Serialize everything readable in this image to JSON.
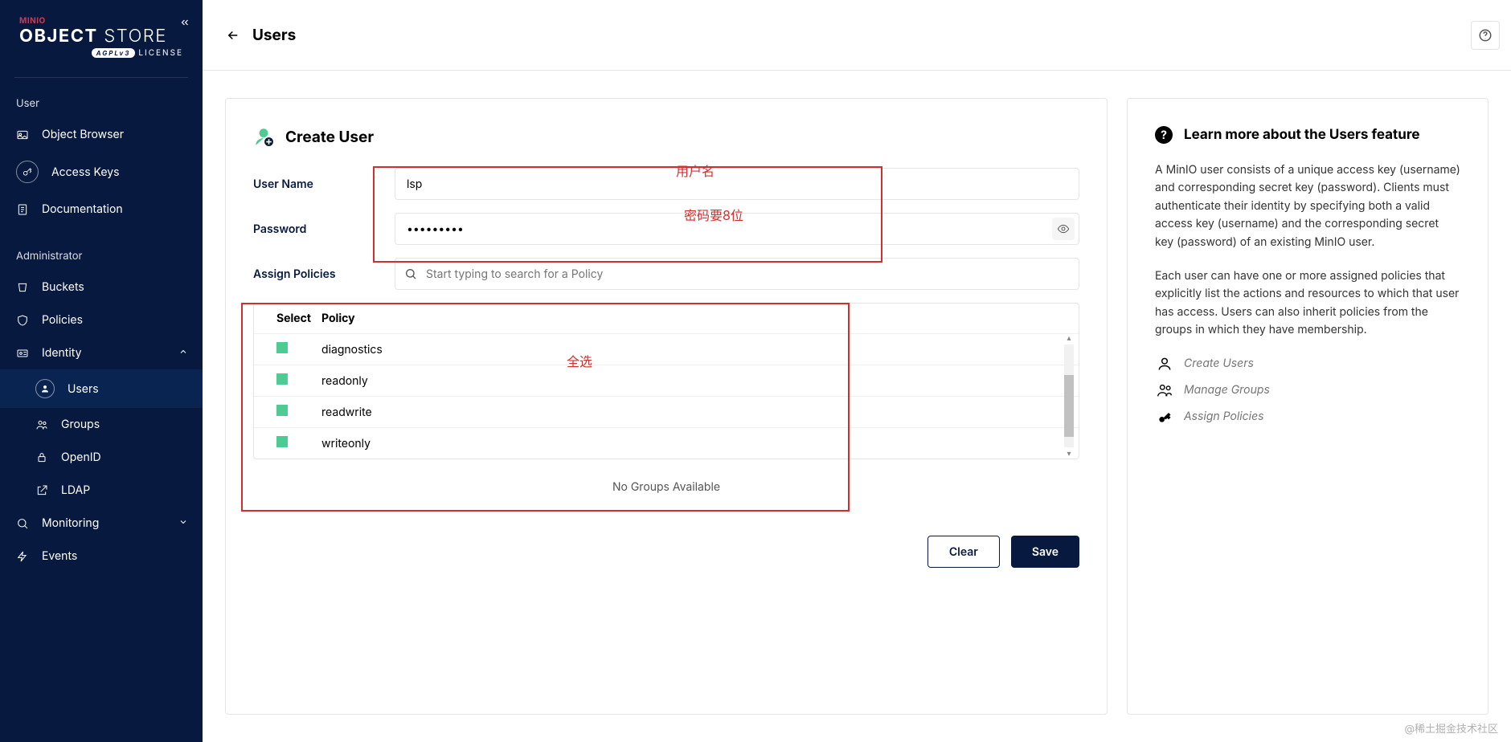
{
  "brand": {
    "name": "MINIO",
    "product1": "OBJECT",
    "product2": "STORE",
    "license_badge": "AGPLv3",
    "license_text": "LICENSE"
  },
  "sidebar": {
    "sections": {
      "user": "User",
      "admin": "Administrator"
    },
    "items": {
      "object_browser": "Object Browser",
      "access_keys": "Access Keys",
      "documentation": "Documentation",
      "buckets": "Buckets",
      "policies": "Policies",
      "identity": "Identity",
      "users": "Users",
      "groups": "Groups",
      "openid": "OpenID",
      "ldap": "LDAP",
      "monitoring": "Monitoring",
      "events": "Events"
    }
  },
  "header": {
    "title": "Users"
  },
  "form": {
    "title": "Create User",
    "labels": {
      "username": "User Name",
      "password": "Password",
      "assign_policies": "Assign Policies"
    },
    "username_value": "lsp",
    "password_value": "•••••••••",
    "policy_search_placeholder": "Start typing to search for a Policy",
    "table": {
      "select_header": "Select",
      "policy_header": "Policy",
      "rows": [
        "diagnostics",
        "readonly",
        "readwrite",
        "writeonly"
      ]
    },
    "no_groups": "No Groups Available",
    "buttons": {
      "clear": "Clear",
      "save": "Save"
    }
  },
  "annotations": {
    "username": "用户名",
    "password": "密码要8位",
    "select_all": "全选"
  },
  "info": {
    "title": "Learn more about the Users feature",
    "p1": "A MinIO user consists of a unique access key (username) and corresponding secret key (password). Clients must authenticate their identity by specifying both a valid access key (username) and the corresponding secret key (password) of an existing MinIO user.",
    "p2": "Each user can have one or more assigned policies that explicitly list the actions and resources to which that user has access. Users can also inherit policies from the groups in which they have membership.",
    "links": {
      "create_users": "Create Users",
      "manage_groups": "Manage Groups",
      "assign_policies": "Assign Policies"
    }
  },
  "watermark": "@稀土掘金技术社区"
}
